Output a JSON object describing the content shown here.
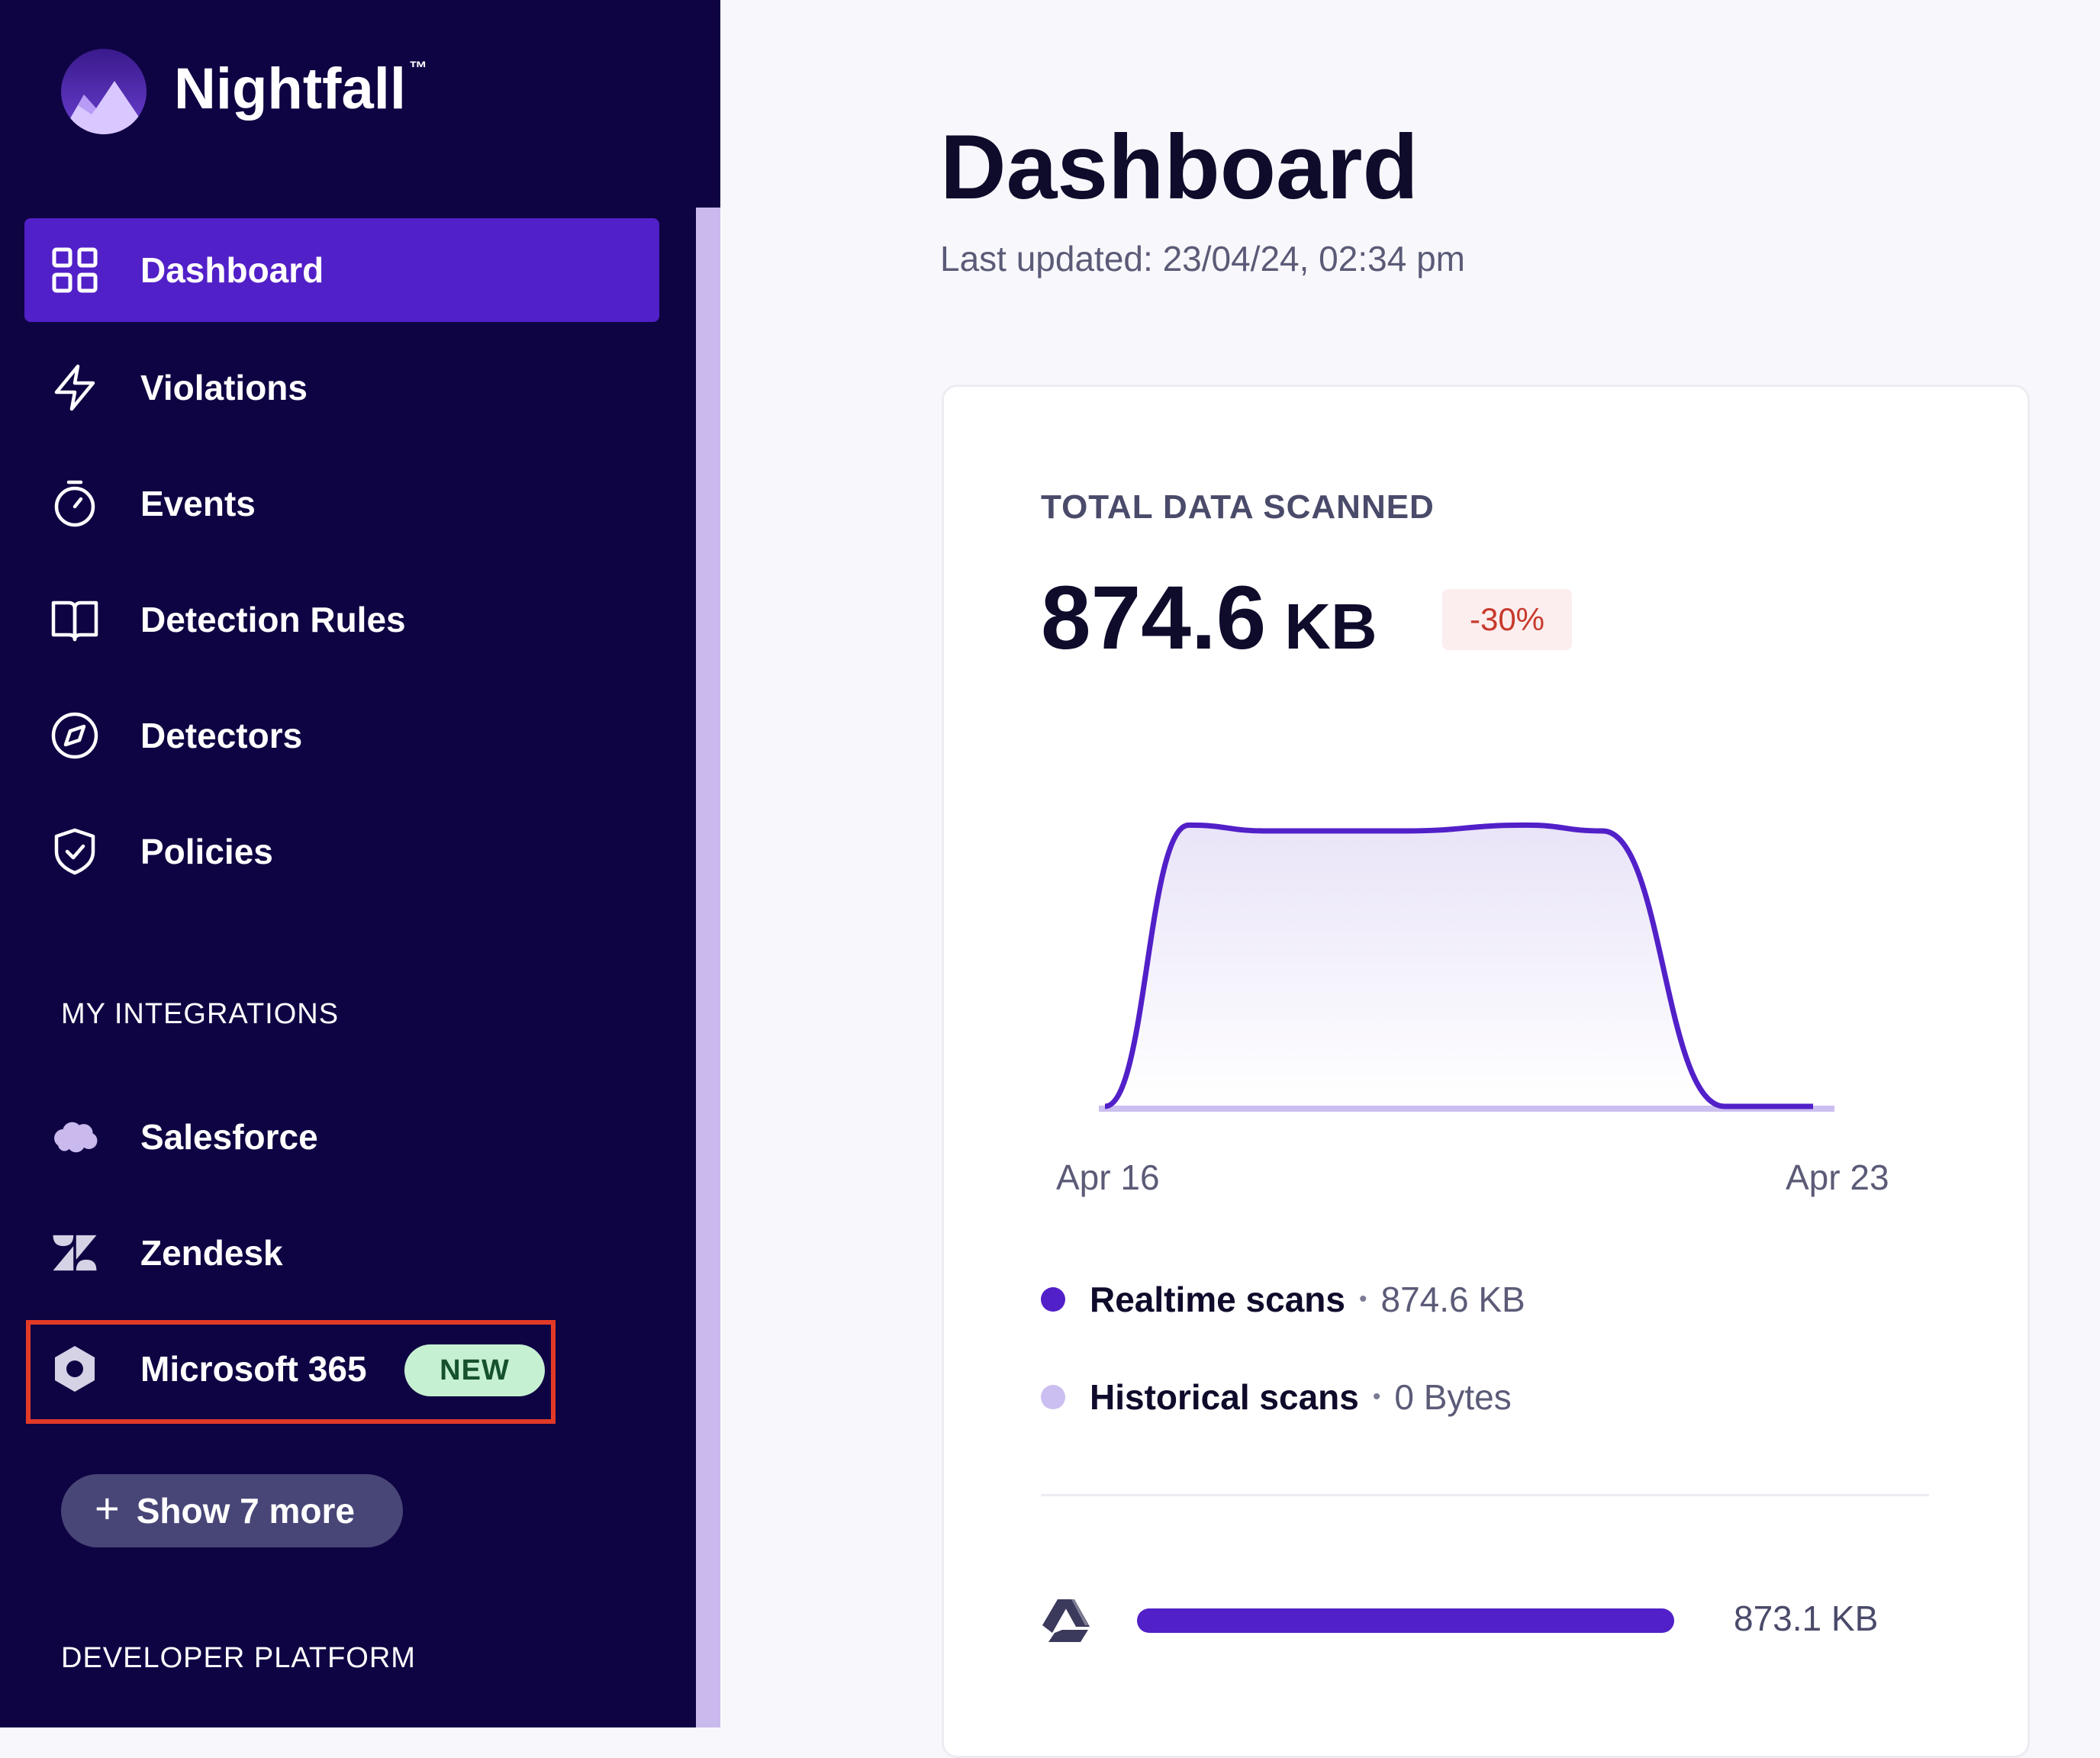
{
  "app": {
    "name": "Nightfall",
    "trademark": "™"
  },
  "colors": {
    "sidebar_bg": "#0e0443",
    "accent": "#5220c8",
    "new_badge": "#c6f0d2",
    "negative": "#c73a2c",
    "historical": "#cbbef0"
  },
  "nav": [
    {
      "label": "Dashboard",
      "icon": "grid-icon",
      "active": true
    },
    {
      "label": "Violations",
      "icon": "lightning-icon"
    },
    {
      "label": "Events",
      "icon": "stopwatch-icon"
    },
    {
      "label": "Detection Rules",
      "icon": "book-icon"
    },
    {
      "label": "Detectors",
      "icon": "compass-icon"
    },
    {
      "label": "Policies",
      "icon": "shield-check-icon"
    }
  ],
  "integrations": {
    "heading": "MY INTEGRATIONS",
    "items": [
      {
        "label": "Salesforce",
        "icon": "salesforce-cloud-icon"
      },
      {
        "label": "Zendesk",
        "icon": "zendesk-icon"
      },
      {
        "label": "Microsoft 365",
        "icon": "microsoft-365-icon",
        "badge": "NEW"
      }
    ],
    "show_more": "Show 7 more"
  },
  "developer": {
    "heading": "DEVELOPER PLATFORM"
  },
  "page": {
    "title": "Dashboard",
    "last_updated": "Last updated: 23/04/24, 02:34 pm"
  },
  "card": {
    "heading": "TOTAL DATA SCANNED",
    "value": "874.6",
    "unit": "KB",
    "change": "-30%",
    "legend": [
      {
        "name": "Realtime scans",
        "value": "874.6 KB",
        "color": "#5220c8"
      },
      {
        "name": "Historical scans",
        "value": "0 Bytes",
        "color": "#cbbef0"
      }
    ],
    "sources": [
      {
        "icon": "google-drive-icon",
        "value": "873.1 KB",
        "fraction": 1.0
      }
    ]
  },
  "chart_data": {
    "type": "area",
    "x_ticks": [
      "Apr 16",
      "Apr 23"
    ],
    "series": [
      {
        "name": "Realtime scans",
        "values": [
          0,
          0.97,
          0.95,
          0.95,
          0.97,
          0.95,
          0,
          0
        ]
      },
      {
        "name": "Historical scans",
        "values": [
          0,
          0,
          0,
          0,
          0,
          0,
          0,
          0
        ]
      }
    ],
    "xlabel": "",
    "ylabel": "",
    "grid": false
  }
}
